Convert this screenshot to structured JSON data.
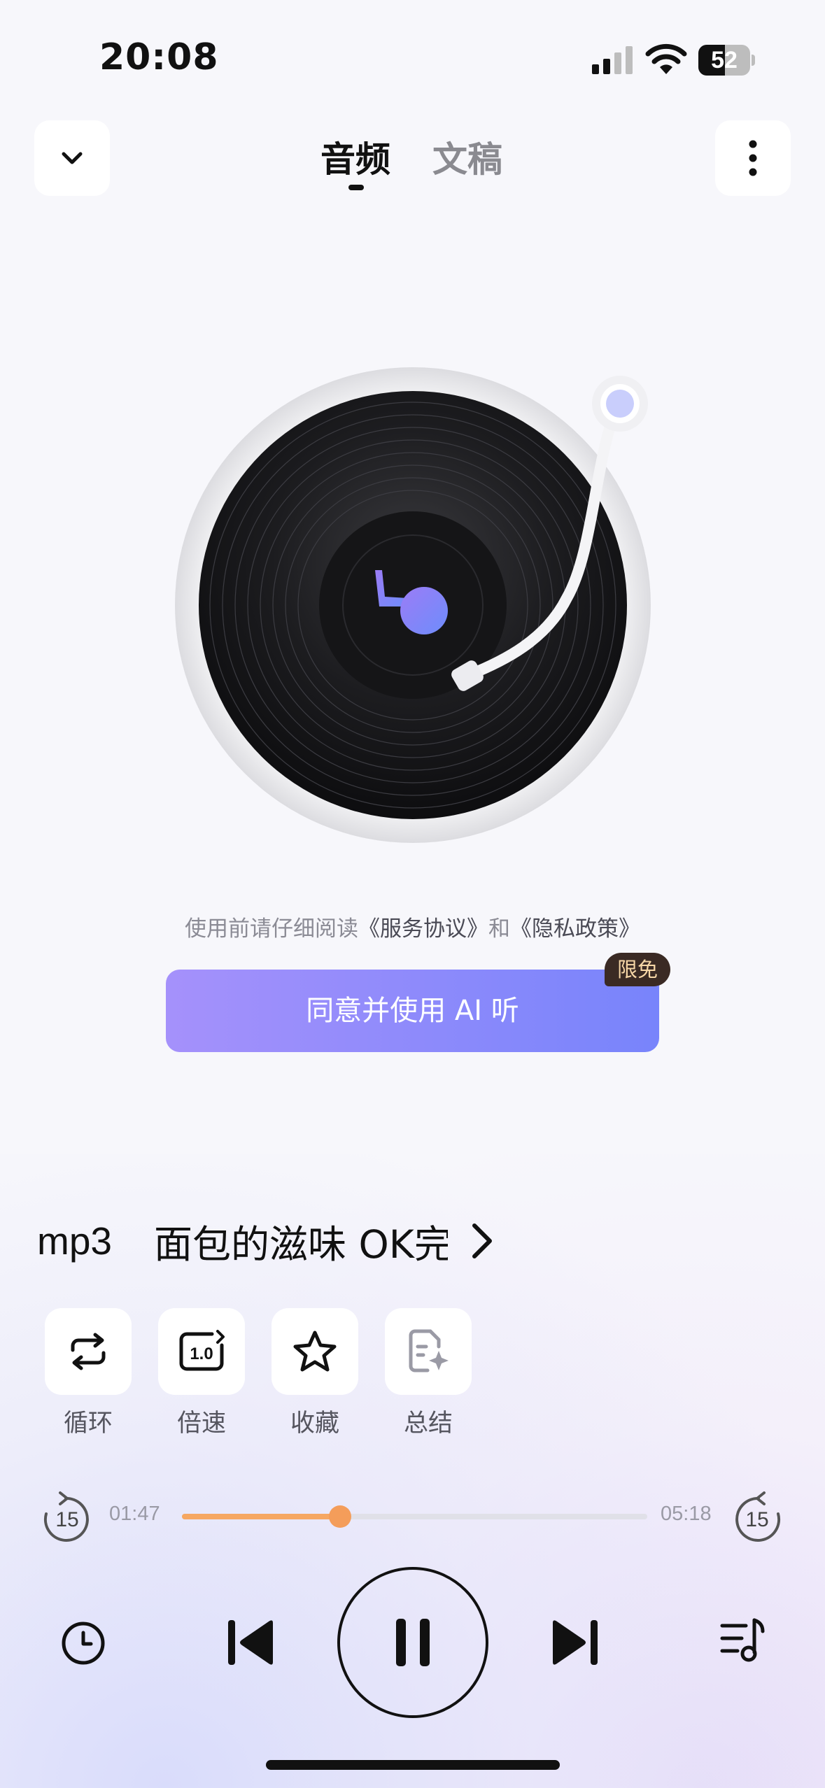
{
  "status": {
    "time": "20:08",
    "battery": "52",
    "battery_level": 0.52
  },
  "header": {
    "tabs": [
      {
        "label": "音频",
        "active": true
      },
      {
        "label": "文稿",
        "active": false
      }
    ],
    "back_icon": "chevron-down-icon",
    "menu_icon": "more-vertical-icon"
  },
  "agreement": {
    "prefix": "使用前请仔细阅读",
    "service_link": "《服务协议》",
    "and": "和",
    "privacy_link": "《隐私政策》",
    "button_label": "同意并使用 AI 听",
    "badge": "限免"
  },
  "track": {
    "ext": "mp3",
    "title": "面包的滋味 OK完"
  },
  "actions": [
    {
      "label": "循环",
      "icon": "repeat-icon"
    },
    {
      "label": "倍速",
      "icon": "speed-icon",
      "icon_text": "1.0"
    },
    {
      "label": "收藏",
      "icon": "star-icon"
    },
    {
      "label": "总结",
      "icon": "summary-icon"
    }
  ],
  "progress": {
    "current": "01:47",
    "total": "05:18",
    "fraction": 0.34,
    "skip_back": "15",
    "skip_forward": "15"
  },
  "colors": {
    "accent_start": "#a591fb",
    "accent_end": "#7884fb",
    "progress": "#f6a762"
  }
}
